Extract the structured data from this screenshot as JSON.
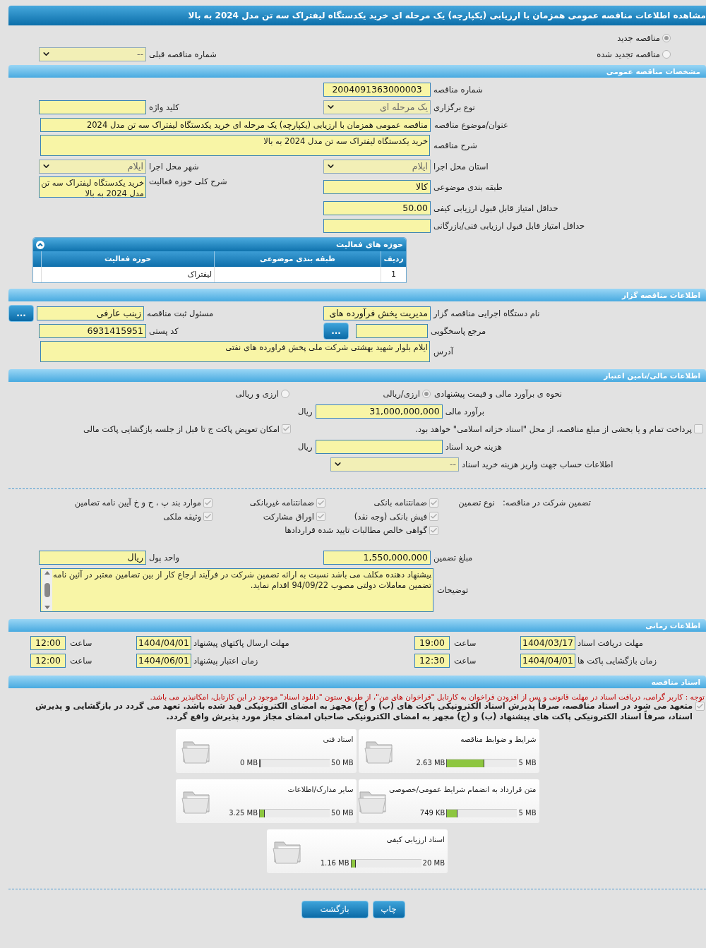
{
  "title": "مشاهده اطلاعات مناقصه عمومی همزمان با ارزیابی (یکپارچه) یک مرحله ای خرید یکدستگاه لیفتراک سه تن مدل 2024 به بالا",
  "top_rows": [
    {
      "right": {
        "kind": "radio",
        "label": "مناقصه جدید",
        "selected": true
      }
    },
    {
      "right": {
        "kind": "radio",
        "label": "مناقصه تجدید شده",
        "selected": false
      },
      "left": {
        "kind": "select",
        "label": "شماره مناقصه قبلی",
        "value": "--"
      }
    }
  ],
  "sections": [
    {
      "title": "مشخصات مناقصه عمومی",
      "rows": [
        {
          "right": {
            "kind": "text",
            "label": "شماره مناقصه",
            "value": "2004091363000003",
            "centered": true
          }
        },
        {
          "right": {
            "kind": "select",
            "label": "نوع برگزاری",
            "value": "یک مرحله ای"
          },
          "left": {
            "kind": "text",
            "label": "کلید واژه"
          }
        },
        {
          "full": {
            "kind": "text",
            "label": "عنوان/موضوع مناقصه",
            "value": "مناقصه عمومی همزمان با ارزیابی (یکپارچه) یک مرحله ای خرید یکدستگاه لیفتراک سه تن مدل 2024"
          }
        },
        {
          "full": {
            "kind": "area",
            "label": "شرح مناقصه",
            "value": "خرید یکدستگاه لیفتراک سه تن مدل 2024 به بالا"
          }
        },
        {
          "right": {
            "kind": "select",
            "label": "استان محل اجرا",
            "value": "ایلام"
          },
          "left": {
            "kind": "select",
            "label": "شهر محل اجرا",
            "value": "ایلام"
          }
        },
        {
          "right": {
            "kind": "text",
            "label": "طبقه بندی موضوعی",
            "value": "کالا"
          },
          "left": {
            "kind": "area",
            "label": "شرح کلی حوزه فعالیت",
            "value": "خرید یکدستگاه لیفتراک سه تن مدل 2024 به بالا"
          }
        },
        {
          "right": {
            "kind": "text",
            "label": "حداقل امتیاز قابل قبول ارزیابی کیفی",
            "value": "50.00"
          }
        },
        {
          "right": {
            "kind": "text",
            "label": "حداقل امتیاز قابل قبول ارزیابی فنی/بازرگانی"
          }
        }
      ],
      "table": {
        "title": "حوزه های فعالیت",
        "columns": [
          "ردیف",
          "طبقه بندی موضوعی",
          "حوزه فعالیت"
        ],
        "rows": [
          {
            "row": "1",
            "activity": "لیفتراک"
          }
        ]
      }
    },
    {
      "title": "اطلاعات مناقصه گزار",
      "rows": [
        {
          "right": {
            "kind": "text",
            "label": "نام دستگاه اجرایی مناقصه گزار",
            "value": "مدیریت پخش فرآورده های"
          },
          "left": {
            "kind": "text",
            "label": "مسئول ثبت مناقصه",
            "value": "زینب عارفی",
            "button": "..."
          }
        },
        {
          "right": {
            "kind": "text",
            "label": "مرجع پاسخگویی",
            "button": "..."
          },
          "left": {
            "kind": "text",
            "label": "کد پستی",
            "value": "6931415951"
          }
        },
        {
          "full": {
            "kind": "area",
            "label": "آدرس",
            "value": "ایلام بلوار شهید بهشتی شرکت ملی پخش فراورده های نفتی"
          }
        }
      ]
    },
    {
      "title": "اطلاعات مالی/تامین اعتبار",
      "rows": [
        {
          "full": {
            "kind": "radios",
            "label": "نحوه ی برآورد مالی و قیمت پیشنهادی",
            "options": [
              {
                "label": "ارزی/ریالی",
                "selected": true
              },
              {
                "label": "ارزی و ریالی",
                "selected": false
              }
            ]
          }
        },
        {
          "right": {
            "kind": "text",
            "label": "برآورد مالی",
            "value": "31,000,000,000",
            "suffix": "ریال"
          }
        },
        {
          "right": {
            "kind": "check",
            "label": "پرداخت تمام و یا بخشی از مبلغ مناقصه، از محل \"اسناد خزانه اسلامی\" خواهد بود.",
            "checked": false
          },
          "left": {
            "kind": "check",
            "label": "امکان تعویض پاکت ج تا قبل از جلسه بازگشایی پاکت مالی",
            "checked": true
          }
        },
        {
          "right": {
            "kind": "text",
            "label": "هزینه خرید اسناد",
            "suffix": "ریال"
          }
        },
        {
          "right": {
            "kind": "select",
            "label": "اطلاعات حساب جهت واریز هزینه خرید اسناد",
            "value": "--",
            "wide": true
          }
        }
      ],
      "guarantee": {
        "label": "تضمین شرکت در مناقصه:",
        "type_label": "نوع تضمین",
        "options": [
          {
            "label": "ضمانتنامه بانکی",
            "checked": true
          },
          {
            "label": "ضمانتنامه غیربانکی",
            "checked": true
          },
          {
            "label": "موارد بند پ ، ح و خ آیین نامه تضامین",
            "checked": true
          },
          {
            "label": "فیش بانکی (وجه نقد)",
            "checked": true
          },
          {
            "label": "اوراق مشارکت",
            "checked": true
          },
          {
            "label": "وثیقه ملکی",
            "checked": true
          },
          {
            "label": "گواهی خالص مطالبات تایید شده قراردادها",
            "checked": true
          }
        ]
      },
      "rows_after": [
        {
          "right": {
            "kind": "text",
            "label": "مبلغ تضمین",
            "value": "1,550,000,000"
          },
          "left": {
            "kind": "text",
            "label": "واحد پول",
            "value": "ریال"
          }
        },
        {
          "full": {
            "kind": "area",
            "label": "توضیحات",
            "value": "پیشنهاد دهنده مکلف می باشد نسبت به ارائه تضمین شرکت در فرآیند ارجاع کار از بین تضامین معتبر در آئین نامه تضمین معاملات دولتی مصوب 94/09/22 اقدام نماید.",
            "scroll": true
          }
        }
      ]
    },
    {
      "title": "اطلاعات زمانی",
      "rows": [
        {
          "right": {
            "kind": "datetime",
            "label": "مهلت دریافت اسناد",
            "date": "1404/03/17",
            "time_label": "ساعت",
            "time": "19:00"
          },
          "left": {
            "kind": "datetime",
            "label": "مهلت ارسال پاکتهای پیشنهاد",
            "date": "1404/04/01",
            "time_label": "ساعت",
            "time": "12:00"
          }
        },
        {
          "right": {
            "kind": "datetime",
            "label": "زمان بازگشایی پاکت ها",
            "date": "1404/04/01",
            "time_label": "ساعت",
            "time": "12:30"
          },
          "left": {
            "kind": "datetime",
            "label": "زمان اعتبار پیشنهاد",
            "date": "1404/06/01",
            "time_label": "ساعت",
            "time": "12:00"
          }
        }
      ]
    },
    {
      "title": "اسناد مناقصه",
      "notice": "توجه : کاربر گرامی، دریافت اسناد در مهلت قانونی و پس از افزودن فراخوان به کارتابل \"فراخوان های من\"، از طریق ستون \"دانلود اسناد\" موجود در این کارتابل، امکانپذیر می باشد.",
      "commitment": {
        "label": "متعهد می شود در اسناد مناقصه، صرفاً پذیرش اسناد الکترونیکی پاکت های (ب) و (ج) مجهز به امضای الکترونیکی قید شده باشد. تعهد می گردد در بازگشایی و پذیرش اسناد، صرفاً اسناد الکترونیکی پاکت های پیشنهاد (ب) و (ج) مجهز به امضای الکترونیکی صاحبان امضای مجاز مورد پذیرش واقع گردد.",
        "checked": true
      },
      "documents": [
        {
          "name": "شرایط و ضوابط مناقصه",
          "used": "2.63 MB",
          "max": "5 MB",
          "level": 0.53
        },
        {
          "name": "اسناد فنی",
          "used": "0 MB",
          "max": "50 MB",
          "level": 0
        },
        {
          "name": "متن قرارداد به انضمام شرایط عمومی/خصوصی",
          "used": "749 KB",
          "max": "5 MB",
          "level": 0.15
        },
        {
          "name": "سایر مدارک/اطلاعات",
          "used": "3.25 MB",
          "max": "50 MB",
          "level": 0.07
        },
        {
          "name": "اسناد ارزیابی کیفی",
          "used": "1.16 MB",
          "max": "20 MB",
          "level": 0.06
        }
      ]
    }
  ],
  "buttons": [
    {
      "kind": "print",
      "label": "چاپ"
    },
    {
      "kind": "back",
      "label": "بازگشت"
    }
  ]
}
